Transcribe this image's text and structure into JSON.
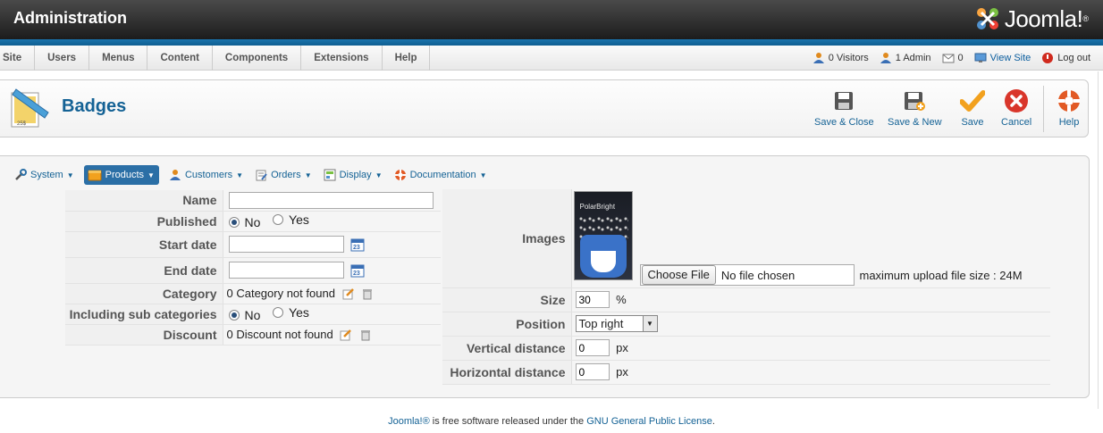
{
  "header": {
    "title": "Administration",
    "logo_text": "Joomla!",
    "logo_mark": "®"
  },
  "menu": {
    "items": [
      "Site",
      "Users",
      "Menus",
      "Content",
      "Components",
      "Extensions",
      "Help"
    ]
  },
  "status": {
    "visitors": "0 Visitors",
    "admins": "1 Admin",
    "messages": "0",
    "view_site": "View Site",
    "logout": "Log out"
  },
  "toolbar": {
    "page_title": "Badges",
    "save_close": "Save & Close",
    "save_new": "Save & New",
    "save": "Save",
    "cancel": "Cancel",
    "help": "Help"
  },
  "submenu": {
    "system": "System",
    "products": "Products",
    "customers": "Customers",
    "orders": "Orders",
    "display": "Display",
    "documentation": "Documentation"
  },
  "form_left": {
    "name_label": "Name",
    "name_value": "",
    "published_label": "Published",
    "published_no": "No",
    "published_yes": "Yes",
    "start_label": "Start date",
    "end_label": "End date",
    "category_label": "Category",
    "category_value": "0 Category not found",
    "subcat_label": "Including sub categories",
    "subcat_no": "No",
    "subcat_yes": "Yes",
    "discount_label": "Discount",
    "discount_value": "0 Discount not found"
  },
  "form_right": {
    "images_label": "Images",
    "product_brand": "PolarBright",
    "choose_file": "Choose File",
    "no_file": "No file chosen",
    "max_upload": "maximum upload file size : 24M",
    "size_label": "Size",
    "size_value": "30",
    "size_unit": "%",
    "position_label": "Position",
    "position_value": "Top right",
    "vertical_label": "Vertical distance",
    "vertical_value": "0",
    "vertical_unit": "px",
    "horizontal_label": "Horizontal distance",
    "horizontal_value": "0",
    "horizontal_unit": "px"
  },
  "footer": {
    "joomla": "Joomla!®",
    "middle": " is free software released under the ",
    "license": "GNU General Public License",
    "end": "."
  },
  "colors": {
    "accent": "#146295",
    "header_dark": "#1c1c1c",
    "strip_blue": "#1a73ad",
    "cancel_red": "#d9362b",
    "save_orange": "#f2a11e"
  }
}
